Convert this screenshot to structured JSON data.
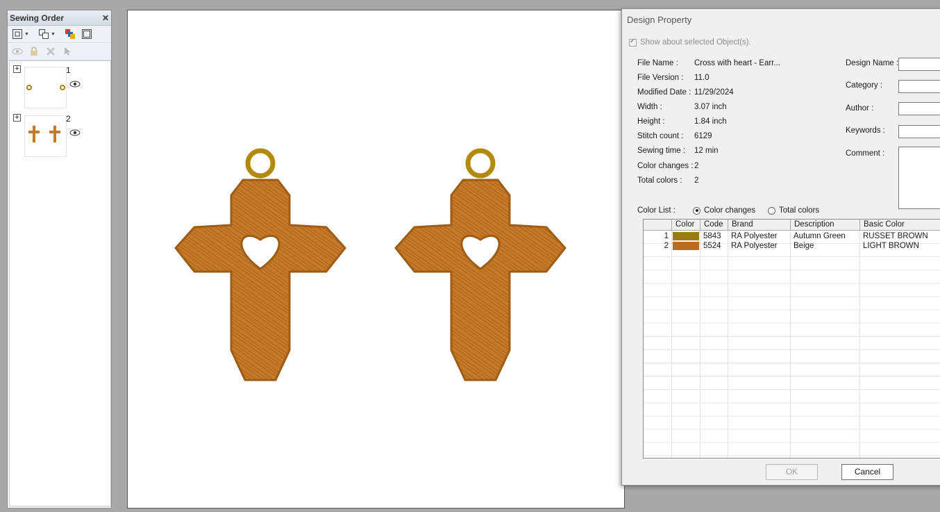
{
  "sewing_order": {
    "title": "Sewing Order",
    "items": [
      {
        "number": "1"
      },
      {
        "number": "2"
      }
    ]
  },
  "dialog": {
    "title": "Design Property",
    "show_selected_label": "Show about selected Object(s).",
    "properties": {
      "file_name_label": "File Name :",
      "file_name_value": "Cross with heart - Earr...",
      "file_version_label": "File Version :",
      "file_version_value": "11.0",
      "modified_date_label": "Modified Date :",
      "modified_date_value": "11/29/2024",
      "width_label": "Width :",
      "width_value": "3.07 inch",
      "height_label": "Height :",
      "height_value": "1.84 inch",
      "stitch_count_label": "Stitch count :",
      "stitch_count_value": "6129",
      "sewing_time_label": "Sewing time :",
      "sewing_time_value": "12 min",
      "color_changes_label": "Color changes :",
      "color_changes_value": "2",
      "total_colors_label": "Total colors :",
      "total_colors_value": "2"
    },
    "fields": {
      "design_name_label": "Design Name :",
      "category_label": "Category :",
      "author_label": "Author :",
      "keywords_label": "Keywords :",
      "comment_label": "Comment :"
    },
    "color_list_label": "Color List :",
    "radio_color_changes": "Color changes",
    "radio_total_colors": "Total colors",
    "table": {
      "headers": {
        "color": "Color",
        "code": "Code",
        "brand": "Brand",
        "description": "Description",
        "basic_color": "Basic Color"
      },
      "rows": [
        {
          "index": "1",
          "swatch": "#9a7a12",
          "code": "5843",
          "brand": "RA Polyester",
          "description": "Autumn Green",
          "basic_color": "RUSSET BROWN"
        },
        {
          "index": "2",
          "swatch": "#b86d22",
          "code": "5524",
          "brand": "RA Polyester",
          "description": "Beige",
          "basic_color": "LIGHT BROWN"
        }
      ]
    },
    "ok_label": "OK",
    "cancel_label": "Cancel"
  },
  "colors": {
    "cross_fill": "#c47a26",
    "cross_edge": "#9e5c14",
    "ring": "#b38a10"
  }
}
